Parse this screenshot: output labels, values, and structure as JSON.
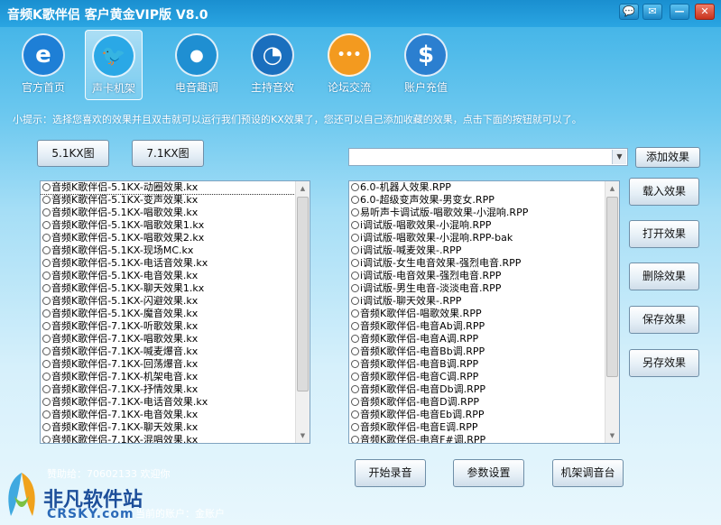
{
  "window": {
    "title": "音频K歌伴侣    客户黄金VIP版 V8.0",
    "controls": [
      "💬",
      "✉",
      "—",
      "✕"
    ]
  },
  "nav": [
    {
      "label": "官方首页",
      "icon": "ie-icon",
      "glyph": "e",
      "color": "#1e7fd6"
    },
    {
      "label": "声卡机架",
      "icon": "twitter-bird-icon",
      "glyph": "🐦",
      "color": "#2aa8e6"
    },
    {
      "label": "电音趣调",
      "icon": "speech-bubble-icon",
      "glyph": "●",
      "color": "#1f8fd2"
    },
    {
      "label": "主持音效",
      "icon": "gauge-icon",
      "glyph": "◔",
      "color": "#1a6fbe"
    },
    {
      "label": "论坛交流",
      "icon": "chat-bubble-icon",
      "glyph": "•••",
      "color": "#f39a1f"
    },
    {
      "label": "账户充值",
      "icon": "money-bag-icon",
      "glyph": "$",
      "color": "#2b7fd0"
    }
  ],
  "tip": "小提示：选择您喜欢的效果并且双击就可以运行我们预设的KX效果了，您还可以自己添加收藏的效果，点击下面的按钮就可以了。",
  "buttons": {
    "kx51": "5.1KX图",
    "kx71": "7.1KX图",
    "add_effect": "添加效果",
    "load_effect": "载入效果",
    "open_effect": "打开效果",
    "delete_effect": "删除效果",
    "save_effect": "保存效果",
    "save_as_effect": "另存效果",
    "start_record": "开始录音",
    "params": "参数设置",
    "rack_console": "机架调音台"
  },
  "left_list": [
    "音频K歌伴侣-5.1KX-动圈效果.kx",
    "音频K歌伴侣-5.1KX-变声效果.kx",
    "音频K歌伴侣-5.1KX-唱歌效果.kx",
    "音频K歌伴侣-5.1KX-唱歌效果1.kx",
    "音频K歌伴侣-5.1KX-唱歌效果2.kx",
    "音频K歌伴侣-5.1KX-现场MC.kx",
    "音频K歌伴侣-5.1KX-电话音效果.kx",
    "音频K歌伴侣-5.1KX-电音效果.kx",
    "音频K歌伴侣-5.1KX-聊天效果1.kx",
    "音频K歌伴侣-5.1KX-闪避效果.kx",
    "音频K歌伴侣-5.1KX-魔音效果.kx",
    "音频K歌伴侣-7.1KX-听歌效果.kx",
    "音频K歌伴侣-7.1KX-唱歌效果.kx",
    "音频K歌伴侣-7.1KX-喊麦爆音.kx",
    "音频K歌伴侣-7.1KX-回荡爆音.kx",
    "音频K歌伴侣-7.1KX-机架电音.kx",
    "音频K歌伴侣-7.1KX-抒情效果.kx",
    "音频K歌伴侣-7.1KX-电话音效果.kx",
    "音频K歌伴侣-7.1KX-电音效果.kx",
    "音频K歌伴侣-7.1KX-聊天效果.kx",
    "音频K歌伴侣-7.1KX-混唱效果.kx"
  ],
  "right_list": [
    "6.0-机器人效果.RPP",
    "6.0-超级变声效果-男变女.RPP",
    "易听声卡调试版-唱歌效果-小混响.RPP",
    "i调试版-唱歌效果-小混响.RPP",
    "i调试版-唱歌效果-小混响.RPP-bak",
    "i调试版-喊麦效果-.RPP",
    "i调试版-女生电音效果-强烈电音.RPP",
    "i调试版-电音效果-强烈电音.RPP",
    "i调试版-男生电音-淡淡电音.RPP",
    "i调试版-聊天效果-.RPP",
    "音频K歌伴侣-唱歌效果.RPP",
    "音频K歌伴侣-电音Ab调.RPP",
    "音频K歌伴侣-电音A调.RPP",
    "音频K歌伴侣-电音Bb调.RPP",
    "音频K歌伴侣-电音B调.RPP",
    "音频K歌伴侣-电音C调.RPP",
    "音频K歌伴侣-电音Db调.RPP",
    "音频K歌伴侣-电音D调.RPP",
    "音频K歌伴侣-电音Eb调.RPP",
    "音频K歌伴侣-电音E调.RPP",
    "音频K歌伴侣-电音F#调.RPP"
  ],
  "footer": {
    "support": "赞助给：70602133 欢迎你",
    "account_prefix": "当前的账户：",
    "account": "金账户"
  },
  "watermark": {
    "name": "非凡软件站",
    "sub": "CRSKY.com"
  }
}
